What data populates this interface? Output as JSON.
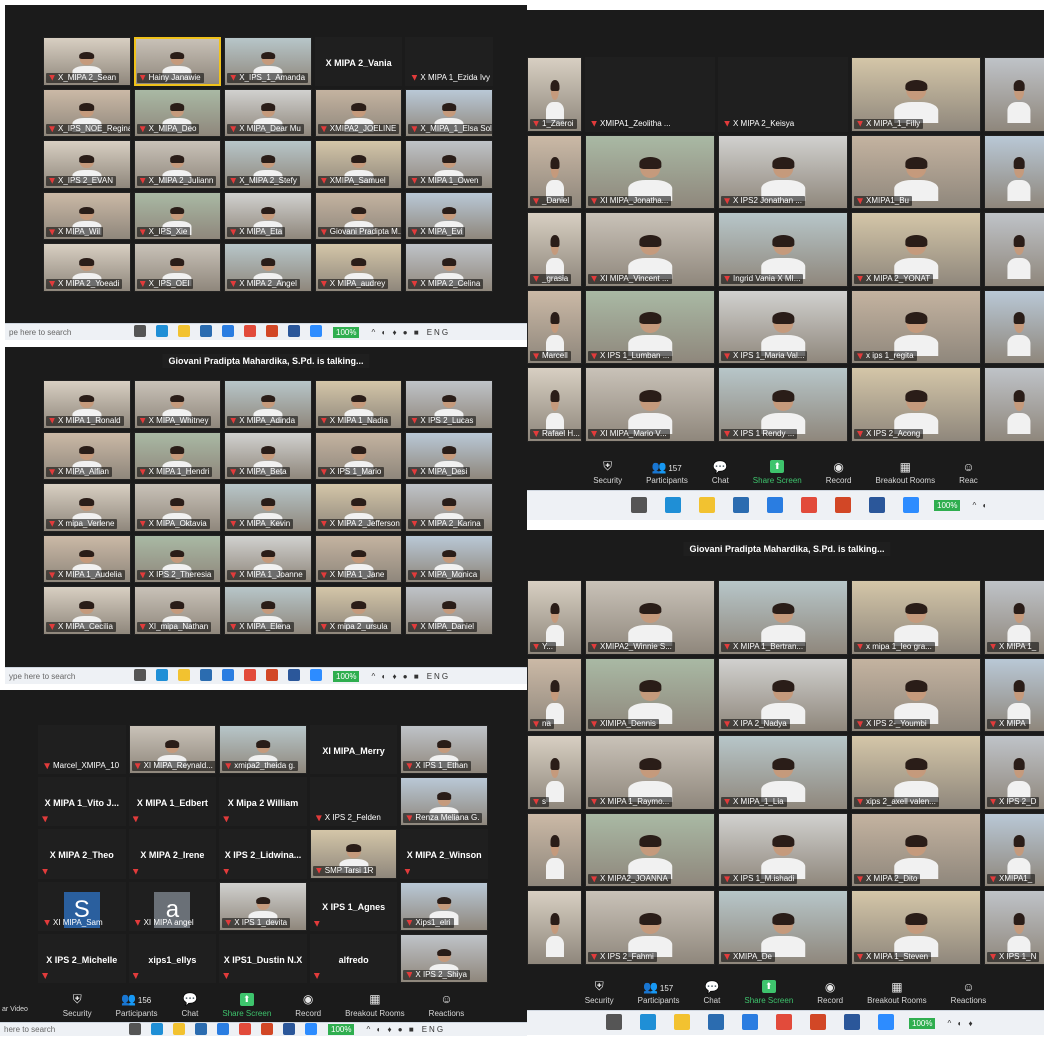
{
  "panels": {
    "p1": {
      "tiles": [
        {
          "name": "X_MIPA 2_Sean",
          "type": "video",
          "mute": true
        },
        {
          "name": "Hainy Janawie",
          "type": "video",
          "mute": false,
          "speaker": true
        },
        {
          "name": "X_IPS_1_Amanda",
          "type": "video",
          "mute": true
        },
        {
          "name": "X MIPA 2_Vania",
          "type": "name",
          "mute": false
        },
        {
          "name": "X MIPA 1_Ezida Ivy",
          "type": "black",
          "mute": true
        },
        {
          "name": "X_IPS_NOE_Regina",
          "type": "video",
          "mute": true
        },
        {
          "name": "X_MIPA_Deo",
          "type": "video",
          "mute": true
        },
        {
          "name": "X MIPA_Dear Mu",
          "type": "video",
          "mute": true
        },
        {
          "name": "XMIPA2_JOELINE",
          "type": "video",
          "mute": true
        },
        {
          "name": "X_MIPA_1_Elsa Sol",
          "type": "video",
          "mute": true
        },
        {
          "name": "X_IPS 2_EVAN",
          "type": "video",
          "mute": true
        },
        {
          "name": "X_MIPA 2_Juliann",
          "type": "video",
          "mute": true
        },
        {
          "name": "X_MIPA 2_Stefy",
          "type": "video",
          "mute": true
        },
        {
          "name": "XMIPA_Samuel",
          "type": "video",
          "mute": true
        },
        {
          "name": "X MIPA 1_Owen",
          "type": "video",
          "mute": true
        },
        {
          "name": "X MIPA_Wil",
          "type": "video",
          "mute": true
        },
        {
          "name": "X_IPS_Xie",
          "type": "video",
          "mute": true
        },
        {
          "name": "X MIPA_Eta",
          "type": "video",
          "mute": true
        },
        {
          "name": "Giovani Pradipta M...",
          "type": "video",
          "mute": false
        },
        {
          "name": "X MIPA_Evi",
          "type": "video",
          "mute": true
        },
        {
          "name": "X MIPA 2_Yoeadi",
          "type": "video",
          "mute": true
        },
        {
          "name": "X_IPS_OEI",
          "type": "video",
          "mute": true
        },
        {
          "name": "X MIPA 2_Angel",
          "type": "video",
          "mute": true
        },
        {
          "name": "X MIPA_audrey",
          "type": "video",
          "mute": true
        },
        {
          "name": "X MIPA 2_Celina",
          "type": "video",
          "mute": true
        }
      ],
      "taskbar": {
        "search": "pe here to search",
        "zoom": "100%",
        "lang": "ENG"
      }
    },
    "p2": {
      "talking": "Giovani Pradipta Mahardika, S.Pd. is talking...",
      "tiles": [
        {
          "name": "X MIPA 1_Ronald",
          "type": "video",
          "mute": true
        },
        {
          "name": "X MIPA_Whitney",
          "type": "video",
          "mute": true
        },
        {
          "name": "X MIPA_Adinda",
          "type": "video",
          "mute": true
        },
        {
          "name": "X MIPA 1_Nadia",
          "type": "video",
          "mute": true
        },
        {
          "name": "X IPS 2_Lucas",
          "type": "video",
          "mute": true
        },
        {
          "name": "X MIPA_Alfian",
          "type": "video",
          "mute": true
        },
        {
          "name": "X MIPA 1_Hendri",
          "type": "video",
          "mute": true
        },
        {
          "name": "X MIPA_Beta",
          "type": "video",
          "mute": true
        },
        {
          "name": "X IPS 1_Mario",
          "type": "video",
          "mute": true
        },
        {
          "name": "X MIPA_Desi",
          "type": "video",
          "mute": true
        },
        {
          "name": "X mipa_Verlene",
          "type": "video",
          "mute": true
        },
        {
          "name": "X MIPA_Oktavia",
          "type": "video",
          "mute": true
        },
        {
          "name": "X MIPA_Kevin",
          "type": "video",
          "mute": true
        },
        {
          "name": "X MIPA 2_Jefferson",
          "type": "video",
          "mute": true
        },
        {
          "name": "X MIPA 2_Karina",
          "type": "video",
          "mute": true
        },
        {
          "name": "X MIPA 1_Audelia",
          "type": "video",
          "mute": true
        },
        {
          "name": "X IPS 2_Theresia",
          "type": "video",
          "mute": true
        },
        {
          "name": "X MIPA 1_Joanne",
          "type": "video",
          "mute": true
        },
        {
          "name": "X MIPA 1_Jane",
          "type": "video",
          "mute": true
        },
        {
          "name": "X MIPA_Monica",
          "type": "video",
          "mute": true
        },
        {
          "name": "X MIPA_Cecilia",
          "type": "video",
          "mute": true
        },
        {
          "name": "XI_mipa_Nathan",
          "type": "video",
          "mute": true
        },
        {
          "name": "X MIPA_Elena",
          "type": "video",
          "mute": true
        },
        {
          "name": "X mipa 2_ursula",
          "type": "video",
          "mute": true
        },
        {
          "name": "X MIPA_Daniel",
          "type": "video",
          "mute": true
        }
      ],
      "taskbar": {
        "search": "ype here to search",
        "zoom": "100%",
        "lang": "ENG"
      }
    },
    "p3": {
      "tiles": [
        {
          "name": "Marcel_XMIPA_10",
          "type": "black",
          "mute": true
        },
        {
          "name": "XI MIPA_Reynald...",
          "type": "video",
          "mute": true
        },
        {
          "name": "xmipa2_theida g.",
          "type": "video",
          "mute": true
        },
        {
          "name": "XI MIPA_Merry",
          "type": "name",
          "mute": false
        },
        {
          "name": "X IPS 1_Ethan",
          "type": "video",
          "mute": true
        },
        {
          "name": "X MIPA 1_Vito J...",
          "type": "name",
          "mute": true
        },
        {
          "name": "X MIPA 1_Edbert",
          "type": "name",
          "mute": true
        },
        {
          "name": "X Mipa 2 William",
          "type": "name",
          "mute": true
        },
        {
          "name": "X IPS 2_Felden",
          "type": "black",
          "mute": true
        },
        {
          "name": "Renza Meliana G.",
          "type": "video",
          "mute": true
        },
        {
          "name": "X MIPA 2_Theo",
          "type": "name",
          "mute": true
        },
        {
          "name": "X MIPA 2_Irene",
          "type": "name",
          "mute": true
        },
        {
          "name": "X IPS 2_Lidwina...",
          "type": "name",
          "mute": true
        },
        {
          "name": "SMP Tarsi 1R",
          "type": "video",
          "mute": true
        },
        {
          "name": "X MIPA 2_Winson",
          "type": "name",
          "mute": true
        },
        {
          "name": "XI MIPA_Sam",
          "type": "avatar",
          "letter": "S",
          "color": "#2a5f9e",
          "mute": true
        },
        {
          "name": "XI MIPA angel",
          "type": "avatar",
          "letter": "a",
          "color": "#6a7077",
          "mute": true
        },
        {
          "name": "X IPS 1_devita",
          "type": "video",
          "mute": true
        },
        {
          "name": "X IPS 1_Agnes",
          "type": "name",
          "mute": true
        },
        {
          "name": "Xips1_elri",
          "type": "video",
          "mute": true
        },
        {
          "name": "X IPS 2_Michelle",
          "type": "name",
          "mute": true
        },
        {
          "name": "xips1_ellys",
          "type": "name",
          "mute": true
        },
        {
          "name": "X IPS1_Dustin N.X",
          "type": "name",
          "mute": true
        },
        {
          "name": "alfredo",
          "type": "name",
          "mute": true
        },
        {
          "name": "X IPS 2_Shiya",
          "type": "video",
          "mute": true
        }
      ],
      "toolbar": [
        {
          "label": "Security",
          "icon": "shield-icon",
          "glyph": "⛨"
        },
        {
          "label": "Participants",
          "icon": "participants-icon",
          "glyph": "👥",
          "count": "156"
        },
        {
          "label": "Chat",
          "icon": "chat-icon",
          "glyph": "💬"
        },
        {
          "label": "Share Screen",
          "icon": "share-screen-icon",
          "glyph": "⬆",
          "share": true
        },
        {
          "label": "Record",
          "icon": "record-icon",
          "glyph": "◉"
        },
        {
          "label": "Breakout Rooms",
          "icon": "breakout-rooms-icon",
          "glyph": "▦"
        },
        {
          "label": "Reactions",
          "icon": "reactions-icon",
          "glyph": "☺"
        }
      ],
      "video_label": "ar Video",
      "taskbar": {
        "search": "here to search",
        "zoom": "100%",
        "lang": "ENG"
      }
    },
    "p4": {
      "tiles": [
        {
          "name": "1_Zaeroi",
          "type": "video",
          "mute": false
        },
        {
          "name": "XMIPA1_Zeolitha ...",
          "type": "black",
          "mute": true
        },
        {
          "name": "X MIPA 2_Keisya",
          "type": "black",
          "mute": true
        },
        {
          "name": "X MIPA_1_Filly",
          "type": "video",
          "mute": true
        },
        {
          "name": "",
          "type": "video",
          "mute": false
        },
        {
          "name": "_Daniel",
          "type": "video",
          "mute": false
        },
        {
          "name": "XI MIPA_Jonatha...",
          "type": "video",
          "mute": true
        },
        {
          "name": "X IPS2 Jonathan ...",
          "type": "video",
          "mute": true
        },
        {
          "name": "XMIPA1_Bu",
          "type": "video",
          "mute": true
        },
        {
          "name": "",
          "type": "video",
          "mute": false
        },
        {
          "name": "_grasia",
          "type": "video",
          "mute": false
        },
        {
          "name": "XI MIPA_Vincent ...",
          "type": "video",
          "mute": true
        },
        {
          "name": "Ingrid Vania X MI...",
          "type": "video",
          "mute": true
        },
        {
          "name": "X MIPA 2_YONAT",
          "type": "video",
          "mute": true
        },
        {
          "name": "",
          "type": "video",
          "mute": false
        },
        {
          "name": "Marcell",
          "type": "video",
          "mute": false
        },
        {
          "name": "X IPS 1_Lumban ...",
          "type": "video",
          "mute": true
        },
        {
          "name": "X IPS 1_Maria Val...",
          "type": "video",
          "mute": true
        },
        {
          "name": "x ips 1_regita",
          "type": "video",
          "mute": true
        },
        {
          "name": "",
          "type": "video",
          "mute": false
        },
        {
          "name": "Rafael H...",
          "type": "video",
          "mute": false
        },
        {
          "name": "XI MIPA_Mario V...",
          "type": "video",
          "mute": true
        },
        {
          "name": "X IPS 1 Rendy ...",
          "type": "video",
          "mute": true
        },
        {
          "name": "X IPS 2_Acong",
          "type": "video",
          "mute": true
        },
        {
          "name": "",
          "type": "video",
          "mute": false
        }
      ],
      "toolbar": [
        {
          "label": "Security",
          "icon": "shield-icon",
          "glyph": "⛨"
        },
        {
          "label": "Participants",
          "icon": "participants-icon",
          "glyph": "👥",
          "count": "157"
        },
        {
          "label": "Chat",
          "icon": "chat-icon",
          "glyph": "💬"
        },
        {
          "label": "Share Screen",
          "icon": "share-screen-icon",
          "glyph": "⬆",
          "share": true
        },
        {
          "label": "Record",
          "icon": "record-icon",
          "glyph": "◉"
        },
        {
          "label": "Breakout Rooms",
          "icon": "breakout-rooms-icon",
          "glyph": "▦"
        },
        {
          "label": "Reac",
          "icon": "reactions-icon",
          "glyph": "☺"
        }
      ],
      "taskbar": {
        "zoom": "100%"
      }
    },
    "p5": {
      "talking": "Giovani Pradipta Mahardika, S.Pd. is talking...",
      "tiles": [
        {
          "name": "Y...",
          "type": "video",
          "mute": false
        },
        {
          "name": "XMIPA2_Winnie S...",
          "type": "video",
          "mute": true
        },
        {
          "name": "X MIPA 1_Bertran...",
          "type": "video",
          "mute": true
        },
        {
          "name": "x mipa 1_leo gra...",
          "type": "video",
          "mute": true
        },
        {
          "name": "X MIPA 1_",
          "type": "video",
          "mute": true
        },
        {
          "name": "na",
          "type": "video",
          "mute": false
        },
        {
          "name": "XIMIPA_Dennis",
          "type": "video",
          "mute": true
        },
        {
          "name": "X IPA 2_Nadya",
          "type": "video",
          "mute": true
        },
        {
          "name": "X IPS 2-_Youmbi",
          "type": "video",
          "mute": true
        },
        {
          "name": "X MIPA",
          "type": "video",
          "mute": true
        },
        {
          "name": "s",
          "type": "video",
          "mute": false
        },
        {
          "name": "X MIPA 1_Raymo...",
          "type": "video",
          "mute": true
        },
        {
          "name": "X MIPA_1_Lia",
          "type": "video",
          "mute": true
        },
        {
          "name": "xips 2_axell valen...",
          "type": "video",
          "mute": true
        },
        {
          "name": "X IPS 2_D",
          "type": "video",
          "mute": true
        },
        {
          "name": "",
          "type": "video",
          "mute": false
        },
        {
          "name": "X MIPA2_JOANNA",
          "type": "video",
          "mute": true
        },
        {
          "name": "X IPS 1_M.ishadi",
          "type": "video",
          "mute": true
        },
        {
          "name": "X MIPA 2_Dito",
          "type": "video",
          "mute": true
        },
        {
          "name": "XMIPA1_",
          "type": "video",
          "mute": true
        },
        {
          "name": "",
          "type": "video",
          "mute": false
        },
        {
          "name": "X IPS 2_Fahmi",
          "type": "video",
          "mute": true
        },
        {
          "name": "XMIPA_De",
          "type": "video",
          "mute": true
        },
        {
          "name": "X MIPA 1_Steven",
          "type": "video",
          "mute": true
        },
        {
          "name": "X IPS 1_N",
          "type": "video",
          "mute": true
        }
      ],
      "toolbar": [
        {
          "label": "Security",
          "icon": "shield-icon",
          "glyph": "⛨"
        },
        {
          "label": "Participants",
          "icon": "participants-icon",
          "glyph": "👥",
          "count": "157"
        },
        {
          "label": "Chat",
          "icon": "chat-icon",
          "glyph": "💬"
        },
        {
          "label": "Share Screen",
          "icon": "share-screen-icon",
          "glyph": "⬆",
          "share": true
        },
        {
          "label": "Record",
          "icon": "record-icon",
          "glyph": "◉"
        },
        {
          "label": "Breakout Rooms",
          "icon": "breakout-rooms-icon",
          "glyph": "▦"
        },
        {
          "label": "Reactions",
          "icon": "reactions-icon",
          "glyph": "☺"
        }
      ],
      "taskbar": {
        "zoom": "100%"
      }
    }
  },
  "colors": {
    "zoom_bg": "#1b1b1b",
    "speaker_border": "#f0c21a",
    "share_green": "#3ec46d",
    "mute_red": "#e23b3b",
    "taskbar_bg": "#eef1f5"
  },
  "taskbar_icons": [
    "task-view-icon",
    "edge-icon",
    "file-explorer-icon",
    "store-icon",
    "launcher-icon",
    "chrome-icon",
    "powerpoint-icon",
    "word-icon",
    "zoom-icon"
  ]
}
